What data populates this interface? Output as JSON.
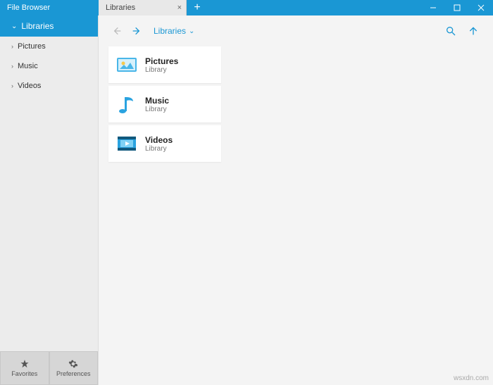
{
  "app": {
    "title": "File Browser"
  },
  "tabs": [
    {
      "label": "Libraries"
    }
  ],
  "window_controls": {
    "minimize": "minimize",
    "maximize": "maximize",
    "close": "close"
  },
  "sidebar": {
    "header": "Libraries",
    "items": [
      {
        "label": "Pictures"
      },
      {
        "label": "Music"
      },
      {
        "label": "Videos"
      }
    ],
    "footer": {
      "favorites": "Favorites",
      "preferences": "Preferences"
    }
  },
  "toolbar": {
    "breadcrumb": "Libraries"
  },
  "libraries": [
    {
      "name": "Pictures",
      "subtitle": "Library",
      "icon": "pictures"
    },
    {
      "name": "Music",
      "subtitle": "Library",
      "icon": "music"
    },
    {
      "name": "Videos",
      "subtitle": "Library",
      "icon": "videos"
    }
  ],
  "watermark": "wsxdn.com",
  "colors": {
    "accent": "#1a97d4"
  }
}
